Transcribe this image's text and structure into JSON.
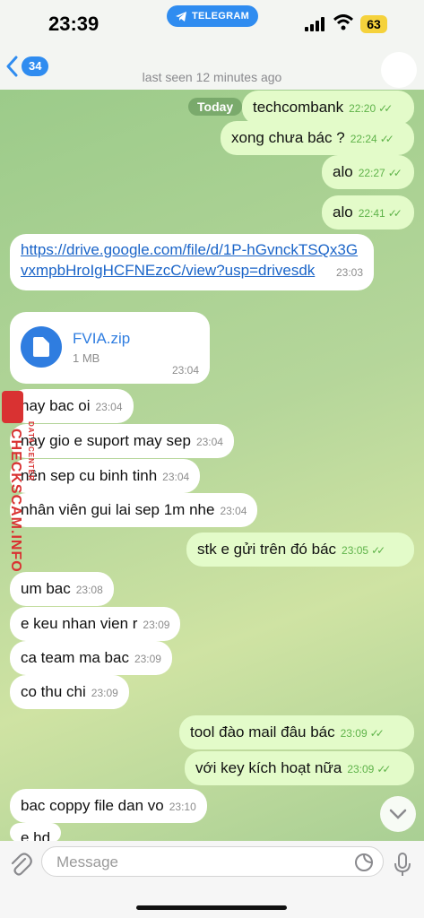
{
  "status_bar": {
    "time": "23:39",
    "pill_label": "TELEGRAM",
    "battery": "63"
  },
  "header": {
    "back_count": "34",
    "last_seen": "last seen 12 minutes ago"
  },
  "date_label": "Today",
  "messages": [
    {
      "dir": "out",
      "text": "techcombank",
      "time": "22:20"
    },
    {
      "dir": "out",
      "text": "xong chưa bác ?",
      "time": "22:24"
    },
    {
      "dir": "out",
      "text": "alo",
      "time": "22:27"
    },
    {
      "dir": "out",
      "text": "alo",
      "time": "22:41"
    },
    {
      "dir": "in",
      "text": "https://drive.google.com/file/d/1P-hGvnckTSQx3GvxmpbHroIgHCFNEzcC/view?usp=drivesdk",
      "time": "23:03"
    },
    {
      "dir": "in",
      "file_name": "FVIA.zip",
      "file_size": "1 MB",
      "time": "23:04"
    },
    {
      "dir": "in",
      "text": "nay bac oi",
      "time": "23:04"
    },
    {
      "dir": "in",
      "text": "nay gio e suport may sep",
      "time": "23:04"
    },
    {
      "dir": "in",
      "text": "nên sep cu binh tinh",
      "time": "23:04"
    },
    {
      "dir": "in",
      "text": "nhân viên gui lai sep 1m nhe",
      "time": "23:04"
    },
    {
      "dir": "out",
      "text": "stk e gửi trên đó bác",
      "time": "23:05"
    },
    {
      "dir": "in",
      "text": "um bac",
      "time": "23:08"
    },
    {
      "dir": "in",
      "text": "e keu nhan vien r",
      "time": "23:09"
    },
    {
      "dir": "in",
      "text": "ca team ma bac",
      "time": "23:09"
    },
    {
      "dir": "in",
      "text": "co thu chi",
      "time": "23:09"
    },
    {
      "dir": "out",
      "text": "tool đào mail đâu bác",
      "time": "23:09"
    },
    {
      "dir": "out",
      "text": "với key kích hoạt nữa",
      "time": "23:09"
    },
    {
      "dir": "in",
      "text": "bac coppy file dan vo",
      "time": "23:10"
    },
    {
      "dir": "in",
      "text": "e hd",
      "time": ""
    }
  ],
  "watermark": {
    "site": "CHECKSCAM.INFO",
    "small": "DATA CENTER"
  },
  "input": {
    "placeholder": "Message"
  },
  "colors": {
    "accent": "#2f8cf0",
    "outgoing": "#e3fbc9",
    "incoming": "#ffffff",
    "check": "#5fb34a"
  }
}
